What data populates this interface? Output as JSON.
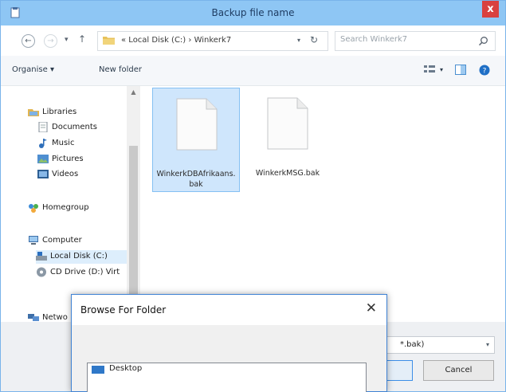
{
  "window": {
    "title": "Backup file name",
    "close_label": "x"
  },
  "address": {
    "breadcrumb_parts": [
      "Local Disk (C:)",
      "Winkerk7"
    ],
    "separator": "›",
    "overflow_marker": "«",
    "text": "« Local Disk (C:)  ›  Winkerk7",
    "search_placeholder": "Search Winkerk7"
  },
  "toolbar": {
    "organise_label": "Organise ▾",
    "new_folder_label": "New folder"
  },
  "sidebar": {
    "items": [
      {
        "label": "Libraries",
        "icon": "libraries-icon"
      },
      {
        "label": "Documents",
        "icon": "documents-icon"
      },
      {
        "label": "Music",
        "icon": "music-icon"
      },
      {
        "label": "Pictures",
        "icon": "pictures-icon"
      },
      {
        "label": "Videos",
        "icon": "videos-icon"
      },
      {
        "label": "Homegroup",
        "icon": "homegroup-icon"
      },
      {
        "label": "Computer",
        "icon": "computer-icon"
      },
      {
        "label": "Local Disk (C:)",
        "icon": "local-disk-icon"
      },
      {
        "label": "CD Drive (D:) Virt",
        "icon": "cd-drive-icon"
      },
      {
        "label": "Netwo",
        "icon": "network-icon"
      }
    ]
  },
  "files": [
    {
      "name": "WinkerkDBAfrikaans.bak",
      "selected": true
    },
    {
      "name": "WinkerkMSG.bak",
      "selected": false
    }
  ],
  "bottom": {
    "filetype_text": "*.bak)",
    "save_label": "",
    "cancel_label": "Cancel"
  },
  "folder_dialog": {
    "title": "Browse For Folder",
    "close_label": "✕",
    "tree_first_item": "Desktop"
  },
  "colors": {
    "titlebar": "#8ec6f4",
    "selection": "#cfe6fc",
    "close_button": "#d9413f",
    "dialog_border": "#3f82d4"
  }
}
